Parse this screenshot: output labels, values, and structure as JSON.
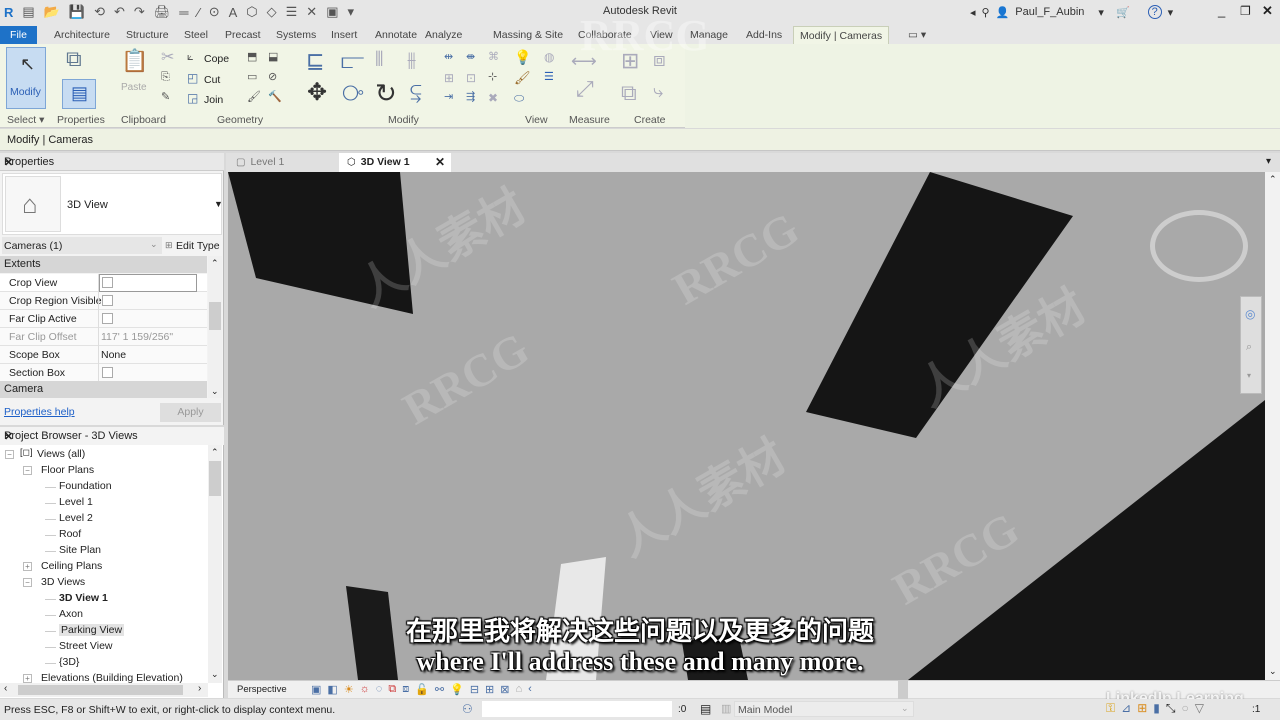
{
  "window": {
    "title": "Autodesk Revit",
    "user": "Paul_F_Aubin",
    "minimize": "_",
    "restore": "❐",
    "close": "✕"
  },
  "quick_access": [
    "R",
    "▤",
    "📂",
    "💾",
    "⟲",
    "↶",
    "↷",
    "🖨",
    "═",
    "⁄",
    "⊙",
    "A",
    "⬡",
    "◇",
    "☰",
    "✕",
    "▣",
    "▾"
  ],
  "ribbon_tabs": [
    {
      "label": "File",
      "state": "file"
    },
    {
      "label": "Architecture"
    },
    {
      "label": "Structure"
    },
    {
      "label": "Steel"
    },
    {
      "label": "Precast"
    },
    {
      "label": "Systems"
    },
    {
      "label": "Insert"
    },
    {
      "label": "Annotate"
    },
    {
      "label": "Analyze"
    },
    {
      "label": "Massing & Site"
    },
    {
      "label": "Collaborate"
    },
    {
      "label": "View"
    },
    {
      "label": "Manage"
    },
    {
      "label": "Add-Ins"
    },
    {
      "label": "Modify | Cameras",
      "state": "active"
    },
    {
      "label": "▭ ▾"
    }
  ],
  "ribbon": {
    "modify_button": "Modify",
    "paste_button": "Paste",
    "cope": "Cope",
    "cut": "Cut",
    "join": "Join",
    "panels": {
      "select": "Select ▾",
      "properties": "Properties",
      "clipboard": "Clipboard",
      "geometry": "Geometry",
      "modify": "Modify",
      "view": "View",
      "measure": "Measure",
      "create": "Create"
    }
  },
  "context_bar": "Modify | Cameras",
  "properties": {
    "title": "Properties",
    "type_name": "3D View",
    "filter": "Cameras (1)",
    "edit_type": "Edit Type",
    "groups": {
      "extents": "Extents",
      "camera": "Camera"
    },
    "rows": [
      {
        "key": "Crop View",
        "type": "checkbox",
        "checked": false
      },
      {
        "key": "Crop Region Visible",
        "type": "checkbox",
        "checked": false
      },
      {
        "key": "Far Clip Active",
        "type": "checkbox",
        "checked": false
      },
      {
        "key": "Far Clip Offset",
        "value": "117'  1 159/256\"",
        "disabled": true
      },
      {
        "key": "Scope Box",
        "value": "None"
      },
      {
        "key": "Section Box",
        "type": "checkbox",
        "checked": false
      }
    ],
    "help_link": "Properties help",
    "apply_button": "Apply"
  },
  "project_browser": {
    "title": "Project Browser - 3D Views",
    "items": [
      {
        "label": "Views (all)",
        "level": 0,
        "toggle": "−"
      },
      {
        "label": "Floor Plans",
        "level": 1,
        "toggle": "−"
      },
      {
        "label": "Foundation",
        "level": 2
      },
      {
        "label": "Level 1",
        "level": 2
      },
      {
        "label": "Level 2",
        "level": 2
      },
      {
        "label": "Roof",
        "level": 2
      },
      {
        "label": "Site Plan",
        "level": 2
      },
      {
        "label": "Ceiling Plans",
        "level": 1,
        "toggle": "+"
      },
      {
        "label": "3D Views",
        "level": 1,
        "toggle": "−"
      },
      {
        "label": "3D View 1",
        "level": 2,
        "bold": true
      },
      {
        "label": "Axon",
        "level": 2
      },
      {
        "label": "Parking View",
        "level": 2,
        "selected": true
      },
      {
        "label": "Street View",
        "level": 2
      },
      {
        "label": "{3D}",
        "level": 2
      },
      {
        "label": "Elevations (Building Elevation)",
        "level": 1,
        "toggle": "+"
      }
    ]
  },
  "doc_tabs": [
    {
      "label": "Level 1",
      "active": false
    },
    {
      "label": "3D View 1",
      "active": true
    }
  ],
  "view_control_bar": {
    "mode": "Perspective"
  },
  "status_bar": {
    "message": "Press ESC, F8 or Shift+W to exit, or right-click to display context menu.",
    "selection_count": ":0",
    "workset": "Main Model",
    "filter_count": ":1"
  },
  "subtitles": {
    "zh": "在那里我将解决这些问题以及更多的问题",
    "en": "where I'll address these and many more."
  },
  "watermarks": {
    "brand": "LinkedIn Learning",
    "rrcg": "RRCG",
    "rr": "人人素材"
  },
  "colors": {
    "accent": "#1e72c8",
    "ribbon_context": "#f1f5e6",
    "viewport": "#a9a9a9"
  }
}
